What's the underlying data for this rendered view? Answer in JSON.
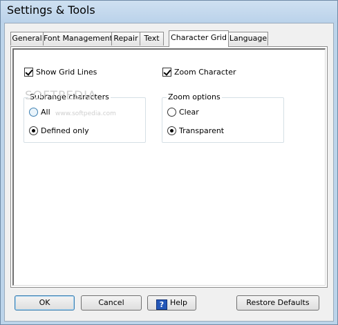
{
  "window": {
    "title": "Settings & Tools"
  },
  "tabs": [
    {
      "label": "General",
      "active": false
    },
    {
      "label": "Font Management",
      "active": false
    },
    {
      "label": "Repair",
      "active": false
    },
    {
      "label": "Text",
      "active": false
    },
    {
      "label": "Character Grid",
      "active": true
    },
    {
      "label": "Language",
      "active": false
    }
  ],
  "options": {
    "show_grid_lines": {
      "label": "Show Grid Lines",
      "checked": true
    },
    "zoom_character": {
      "label": "Zoom Character",
      "checked": true
    }
  },
  "subrange": {
    "title": "Subrange characters",
    "options": [
      {
        "label": "All",
        "selected": false
      },
      {
        "label": "Defined only",
        "selected": true
      }
    ]
  },
  "zoom_options": {
    "title": "Zoom options",
    "options": [
      {
        "label": "Clear",
        "selected": false
      },
      {
        "label": "Transparent",
        "selected": true
      }
    ]
  },
  "watermark": {
    "text": "SOFTPEDIA",
    "sub": "www.softpedia.com"
  },
  "buttons": {
    "ok": "OK",
    "cancel": "Cancel",
    "help": "Help",
    "help_icon_glyph": "?",
    "restore": "Restore Defaults"
  },
  "icons": {
    "help": "help-question-icon"
  }
}
